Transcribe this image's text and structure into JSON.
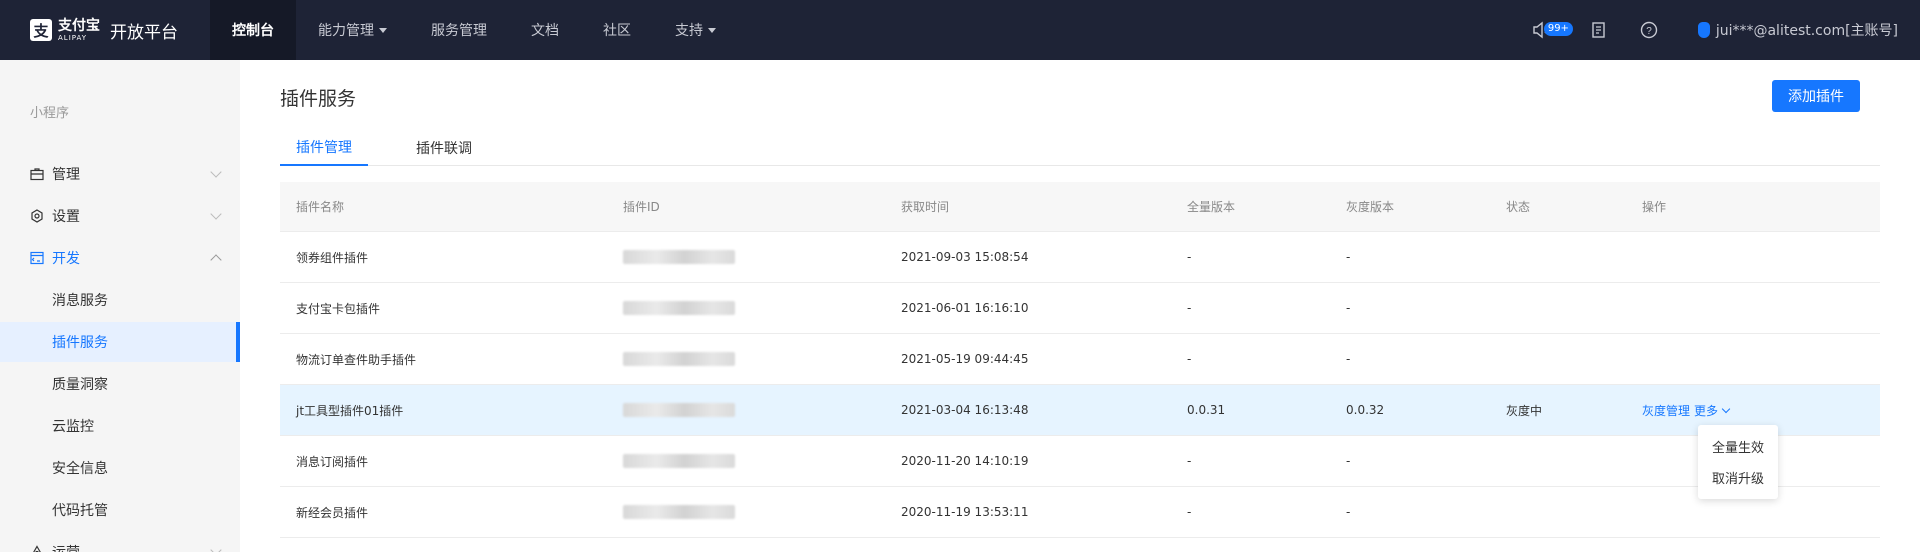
{
  "header": {
    "logo_mark": "支",
    "logo_cn": "支付宝",
    "logo_en": "ALIPAY",
    "platform_title": "开放平台",
    "nav": [
      {
        "label": "控制台"
      },
      {
        "label": "能力管理"
      },
      {
        "label": "服务管理"
      },
      {
        "label": "文档"
      },
      {
        "label": "社区"
      },
      {
        "label": "支持"
      }
    ],
    "notification_badge": "99+",
    "user": "jui***@alitest.com[主账号]",
    "accent": "#1677ff",
    "bg": "#1e2336"
  },
  "sidebar": {
    "section": "小程序",
    "items": [
      {
        "label": "管理",
        "icon": "briefcase-icon"
      },
      {
        "label": "设置",
        "icon": "gear-icon"
      },
      {
        "label": "开发",
        "icon": "code-window-icon"
      },
      {
        "label": "消息服务"
      },
      {
        "label": "插件服务"
      },
      {
        "label": "质量洞察"
      },
      {
        "label": "云监控"
      },
      {
        "label": "安全信息"
      },
      {
        "label": "代码托管"
      },
      {
        "label": "运营",
        "icon": "operation-icon"
      }
    ]
  },
  "main": {
    "title": "插件服务",
    "add_button": "添加插件",
    "tabs": [
      {
        "label": "插件管理"
      },
      {
        "label": "插件联调"
      }
    ],
    "table": {
      "columns": [
        "插件名称",
        "插件ID",
        "获取时间",
        "全量版本",
        "灰度版本",
        "状态",
        "操作"
      ],
      "rows": [
        {
          "name": "领券组件插件",
          "time": "2021-09-03 15:08:54",
          "full": "-",
          "gray": "-",
          "status": "",
          "op": "",
          "more": ""
        },
        {
          "name": "支付宝卡包插件",
          "time": "2021-06-01 16:16:10",
          "full": "-",
          "gray": "-",
          "status": "",
          "op": "",
          "more": ""
        },
        {
          "name": "物流订单查件助手插件",
          "time": "2021-05-19 09:44:45",
          "full": "-",
          "gray": "-",
          "status": "",
          "op": "",
          "more": ""
        },
        {
          "name": "jt工具型插件01插件",
          "time": "2021-03-04 16:13:48",
          "full": "0.0.31",
          "gray": "0.0.32",
          "status": "灰度中",
          "op": "灰度管理",
          "more": "更多"
        },
        {
          "name": "消息订阅插件",
          "time": "2020-11-20 14:10:19",
          "full": "-",
          "gray": "-",
          "status": "",
          "op": "",
          "more": ""
        },
        {
          "name": "新经会员插件",
          "time": "2020-11-19 13:53:11",
          "full": "-",
          "gray": "-",
          "status": "",
          "op": "",
          "more": ""
        }
      ]
    },
    "dropdown": [
      "全量生效",
      "取消升级"
    ]
  }
}
